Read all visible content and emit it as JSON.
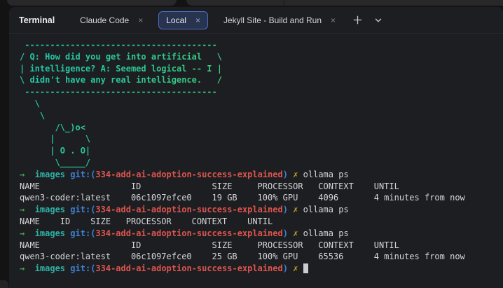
{
  "tabs": {
    "panel_title": "Terminal",
    "items": [
      {
        "label": "Claude Code",
        "active": false
      },
      {
        "label": "Local",
        "active": true
      },
      {
        "label": "Jekyll Site - Build and Run",
        "active": false
      }
    ],
    "close_icon": "×"
  },
  "palette": {
    "terminal_bg": "#1d1e21",
    "active_tab_bg": "#27334f",
    "active_tab_border": "#4d6fc0",
    "art_gradient_start": "#1fc9b1",
    "art_gradient_end": "#a6d32c",
    "prompt_arrow_green": "#43a550",
    "prompt_dir_cyan": "#2fb1a6",
    "git_blue": "#3c82d6",
    "branch_red": "#dd544e",
    "dirty_yellow": "#bfa32f",
    "text": "#d5d6d8",
    "cursor": "#c9cdd1"
  },
  "terminal": {
    "ascii_art": [
      " --------------------------------------",
      "/ Q: How did you get into artificial   \\",
      "| intelligence? A: Seemed logical -- I |",
      "\\ didn't have any real intelligence.   /",
      " --------------------------------------",
      "   \\",
      "    \\",
      "       /\\_)o<",
      "      |      \\",
      "      | O . O|",
      "       \\_____/"
    ],
    "lines": [
      [
        {
          "t": "→",
          "c": "green"
        },
        {
          "t": "  ",
          "c": "fg"
        },
        {
          "t": "images",
          "c": "cyan"
        },
        {
          "t": " ",
          "c": "fg"
        },
        {
          "t": "git:(",
          "c": "blue"
        },
        {
          "t": "334-add-ai-adoption-success-explained",
          "c": "red"
        },
        {
          "t": ")",
          "c": "blue"
        },
        {
          "t": " ",
          "c": "fg"
        },
        {
          "t": "✗",
          "c": "yellow"
        },
        {
          "t": " ollama ps",
          "c": "fg"
        }
      ],
      [
        {
          "t": "NAME                  ID              SIZE     PROCESSOR   CONTEXT    UNTIL",
          "c": "fg"
        }
      ],
      [
        {
          "t": "qwen3-coder:latest    06c1097efce0    19 GB    100% GPU    4096       4 minutes from now",
          "c": "fg"
        }
      ],
      [
        {
          "t": "→",
          "c": "green"
        },
        {
          "t": "  ",
          "c": "fg"
        },
        {
          "t": "images",
          "c": "cyan"
        },
        {
          "t": " ",
          "c": "fg"
        },
        {
          "t": "git:(",
          "c": "blue"
        },
        {
          "t": "334-add-ai-adoption-success-explained",
          "c": "red"
        },
        {
          "t": ")",
          "c": "blue"
        },
        {
          "t": " ",
          "c": "fg"
        },
        {
          "t": "✗",
          "c": "yellow"
        },
        {
          "t": " ollama ps",
          "c": "fg"
        }
      ],
      [
        {
          "t": "NAME    ID    SIZE   PROCESSOR    CONTEXT    UNTIL",
          "c": "fg"
        }
      ],
      [
        {
          "t": "→",
          "c": "green"
        },
        {
          "t": "  ",
          "c": "fg"
        },
        {
          "t": "images",
          "c": "cyan"
        },
        {
          "t": " ",
          "c": "fg"
        },
        {
          "t": "git:(",
          "c": "blue"
        },
        {
          "t": "334-add-ai-adoption-success-explained",
          "c": "red"
        },
        {
          "t": ")",
          "c": "blue"
        },
        {
          "t": " ",
          "c": "fg"
        },
        {
          "t": "✗",
          "c": "yellow"
        },
        {
          "t": " ollama ps",
          "c": "fg"
        }
      ],
      [
        {
          "t": "NAME                  ID              SIZE     PROCESSOR   CONTEXT    UNTIL",
          "c": "fg"
        }
      ],
      [
        {
          "t": "qwen3-coder:latest    06c1097efce0    25 GB    100% GPU    65536      4 minutes from now",
          "c": "fg"
        }
      ],
      [
        {
          "t": "→",
          "c": "green"
        },
        {
          "t": "  ",
          "c": "fg"
        },
        {
          "t": "images",
          "c": "cyan"
        },
        {
          "t": " ",
          "c": "fg"
        },
        {
          "t": "git:(",
          "c": "blue"
        },
        {
          "t": "334-add-ai-adoption-success-explained",
          "c": "red"
        },
        {
          "t": ")",
          "c": "blue"
        },
        {
          "t": " ",
          "c": "fg"
        },
        {
          "t": "✗",
          "c": "yellow"
        },
        {
          "t": " ",
          "c": "fg"
        },
        {
          "t": " ",
          "c": "cursor"
        }
      ]
    ]
  }
}
